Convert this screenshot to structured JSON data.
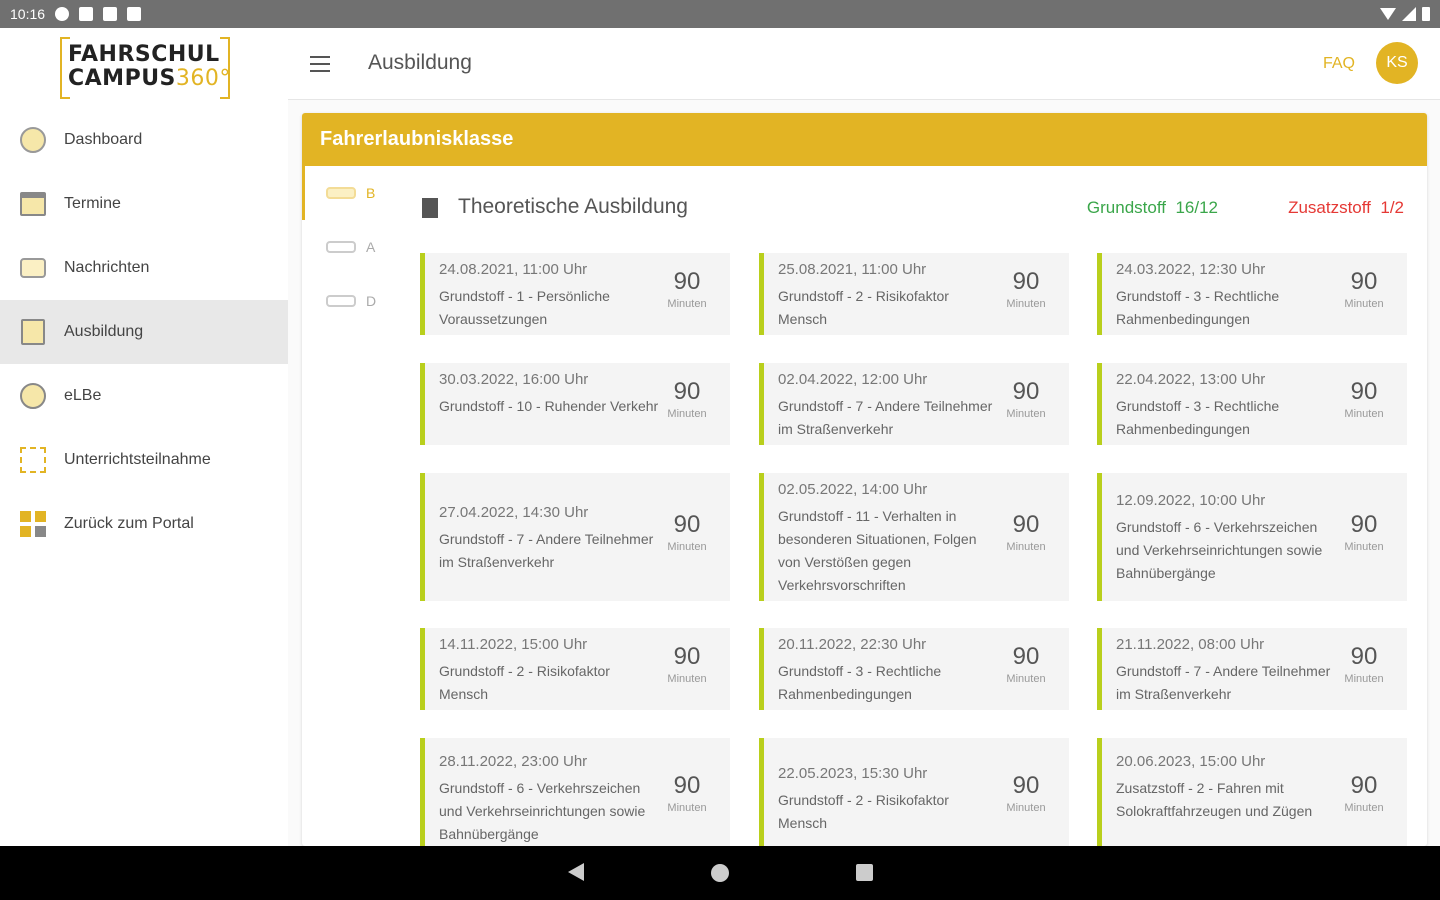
{
  "status": {
    "time": "10:16"
  },
  "app": {
    "logo_line1": "FAHRSCHUL",
    "logo_line2": "CAMPUS",
    "logo_num": "360°",
    "page_title": "Ausbildung",
    "faq": "FAQ",
    "avatar": "KS",
    "accent": "#e2b424"
  },
  "sidebar": {
    "items": [
      {
        "label": "Dashboard",
        "icon": "dashboard-icon"
      },
      {
        "label": "Termine",
        "icon": "calendar-icon"
      },
      {
        "label": "Nachrichten",
        "icon": "messages-icon"
      },
      {
        "label": "Ausbildung",
        "icon": "book-icon",
        "active": true
      },
      {
        "label": "eLBe",
        "icon": "elbe-icon"
      },
      {
        "label": "Unterrichtsteilnahme",
        "icon": "qr-code-icon"
      },
      {
        "label": "Zurück zum Portal",
        "icon": "portal-grid-icon"
      }
    ]
  },
  "main": {
    "card_title": "Fahrerlaubnisklasse",
    "classes": [
      {
        "label": "B",
        "active": true
      },
      {
        "label": "A"
      },
      {
        "label": "D"
      }
    ],
    "section_title": "Theoretische Ausbildung",
    "grundstoff_label": "Grundstoff",
    "grundstoff_value": "16/12",
    "zusatzstoff_label": "Zusatzstoff",
    "zusatzstoff_value": "1/2",
    "grundstoff_color": "#3aa64a",
    "zusatzstoff_color": "#e53935",
    "unit": "Minuten",
    "lessons": [
      {
        "date": "24.08.2021, 11:00 Uhr",
        "topic": "Grundstoff - 1 - Persönliche Voraussetzungen",
        "minutes": "90"
      },
      {
        "date": "25.08.2021, 11:00 Uhr",
        "topic": "Grundstoff - 2 - Risikofaktor Mensch",
        "minutes": "90"
      },
      {
        "date": "24.03.2022, 12:30 Uhr",
        "topic": "Grundstoff - 3 - Rechtliche Rahmenbedingungen",
        "minutes": "90"
      },
      {
        "date": "30.03.2022, 16:00 Uhr",
        "topic": "Grundstoff - 10 - Ruhender Verkehr",
        "minutes": "90"
      },
      {
        "date": "02.04.2022, 12:00 Uhr",
        "topic": "Grundstoff - 7 - Andere Teilnehmer im Straßenverkehr",
        "minutes": "90"
      },
      {
        "date": "22.04.2022, 13:00 Uhr",
        "topic": "Grundstoff - 3 - Rechtliche Rahmenbedingungen",
        "minutes": "90"
      },
      {
        "date": "27.04.2022, 14:30 Uhr",
        "topic": "Grundstoff - 7 - Andere Teilnehmer im Straßenverkehr",
        "minutes": "90"
      },
      {
        "date": "02.05.2022, 14:00 Uhr",
        "topic": "Grundstoff - 11 - Verhalten in besonderen Situationen, Folgen von Verstößen gegen Verkehrsvorschriften",
        "minutes": "90"
      },
      {
        "date": "12.09.2022, 10:00 Uhr",
        "topic": "Grundstoff - 6 - Verkehrszeichen und Verkehrseinrichtungen sowie Bahnübergänge",
        "minutes": "90"
      },
      {
        "date": "14.11.2022, 15:00 Uhr",
        "topic": "Grundstoff - 2 - Risikofaktor Mensch",
        "minutes": "90"
      },
      {
        "date": "20.11.2022, 22:30 Uhr",
        "topic": "Grundstoff - 3 - Rechtliche Rahmenbedingungen",
        "minutes": "90"
      },
      {
        "date": "21.11.2022, 08:00 Uhr",
        "topic": "Grundstoff - 7 - Andere Teilnehmer im Straßenverkehr",
        "minutes": "90"
      },
      {
        "date": "28.11.2022, 23:00 Uhr",
        "topic": "Grundstoff - 6 - Verkehrszeichen und Verkehrseinrichtungen sowie Bahnübergänge",
        "minutes": "90"
      },
      {
        "date": "22.05.2023, 15:30 Uhr",
        "topic": "Grundstoff - 2 - Risikofaktor Mensch",
        "minutes": "90"
      },
      {
        "date": "20.06.2023, 15:00 Uhr",
        "topic": "Zusatzstoff - 2 - Fahren mit Solokraftfahrzeugen und Zügen",
        "minutes": "90"
      }
    ]
  }
}
